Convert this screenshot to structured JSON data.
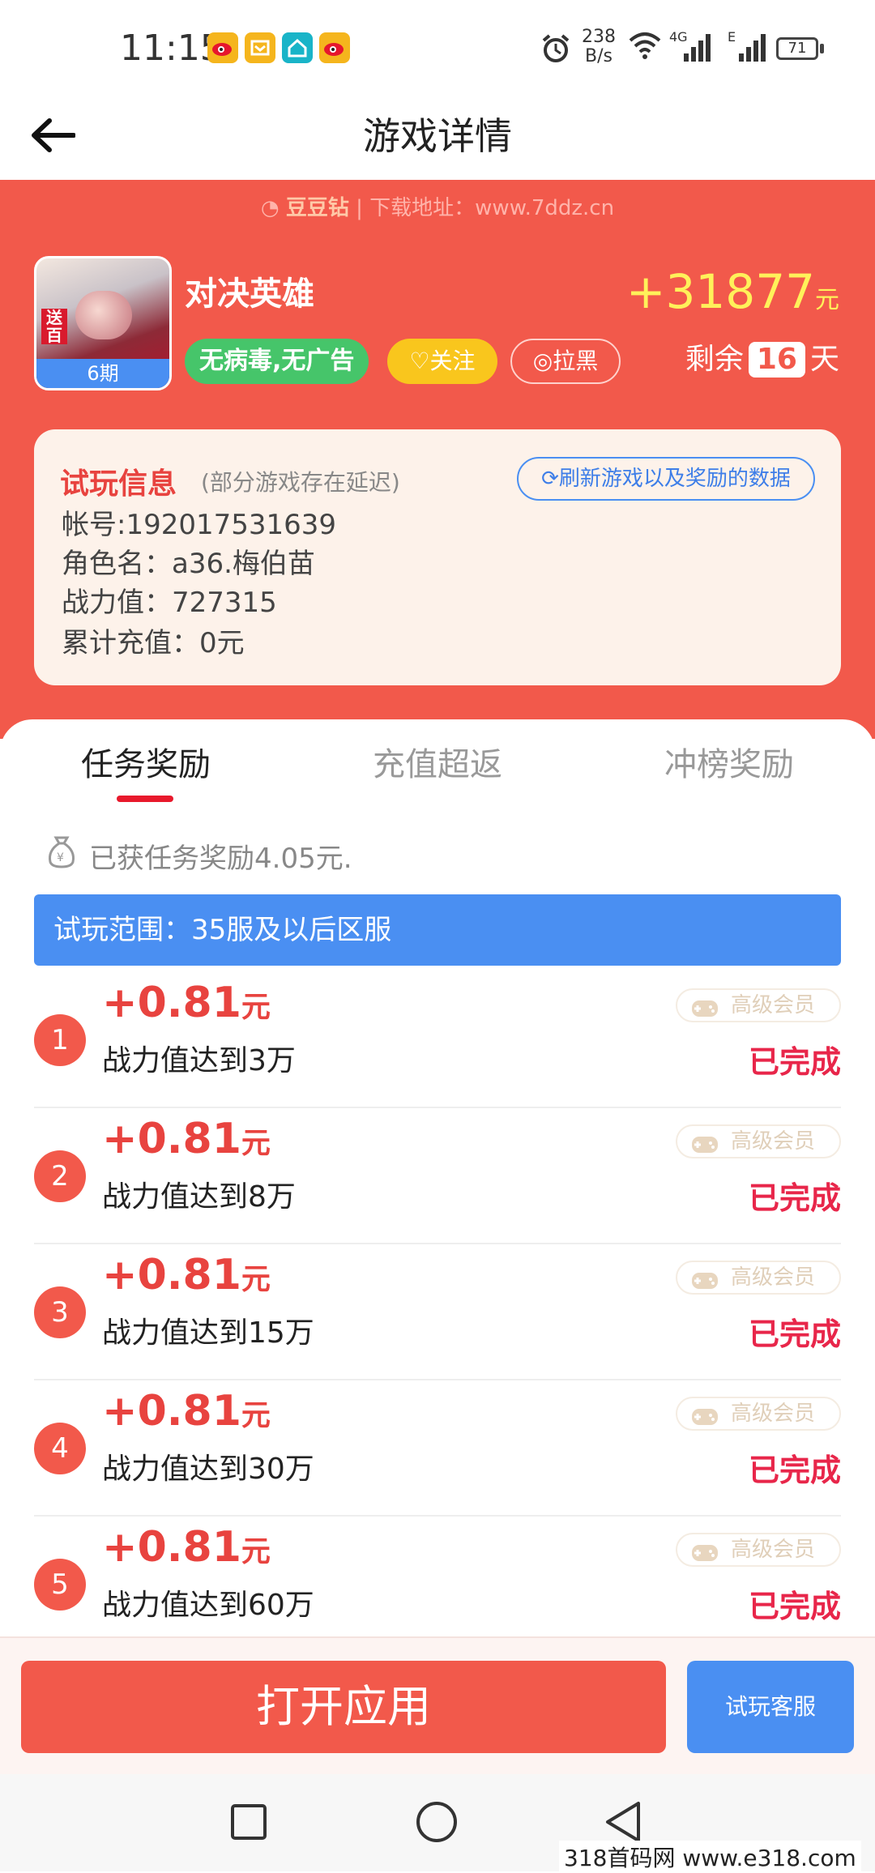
{
  "status_bar": {
    "time": "11:15",
    "net_speed_value": "238",
    "net_speed_unit": "B/s",
    "signal1_label": "4G",
    "signal2_label": "E",
    "battery": "71"
  },
  "header": {
    "title": "游戏详情"
  },
  "banner": {
    "brand": "豆豆钻",
    "separator": "|",
    "download_text": "下载地址：www.7ddz.cn"
  },
  "game": {
    "name": "对决英雄",
    "icon_tag": "送百",
    "period": "6期",
    "tag_safe": "无病毒,无广告",
    "follow_label": "关注",
    "block_label": "拉黑",
    "reward_amount": "+31877",
    "reward_unit": "元",
    "days_prefix": "剩余",
    "days_value": "16",
    "days_suffix": "天"
  },
  "trial_info": {
    "title": "试玩信息",
    "note": "(部分游戏存在延迟)",
    "refresh_label": "刷新游戏以及奖励的数据",
    "account": "帐号:192017531639",
    "role": "角色名：a36.梅伯苗",
    "power": "战力值：727315",
    "recharge": "累计充值：0元"
  },
  "tabs": [
    {
      "label": "任务奖励",
      "active": true
    },
    {
      "label": "充值超返",
      "active": false
    },
    {
      "label": "冲榜奖励",
      "active": false
    }
  ],
  "earned_text": "已获任务奖励4.05元.",
  "scope_text": "试玩范围：35服及以后区服",
  "tasks": [
    {
      "num": "1",
      "amount": "+0.81",
      "unit": "元",
      "desc": "战力值达到3万",
      "badge": "高级会员",
      "status": "已完成"
    },
    {
      "num": "2",
      "amount": "+0.81",
      "unit": "元",
      "desc": "战力值达到8万",
      "badge": "高级会员",
      "status": "已完成"
    },
    {
      "num": "3",
      "amount": "+0.81",
      "unit": "元",
      "desc": "战力值达到15万",
      "badge": "高级会员",
      "status": "已完成"
    },
    {
      "num": "4",
      "amount": "+0.81",
      "unit": "元",
      "desc": "战力值达到30万",
      "badge": "高级会员",
      "status": "已完成"
    },
    {
      "num": "5",
      "amount": "+0.81",
      "unit": "元",
      "desc": "战力值达到60万",
      "badge": "高级会员",
      "status": "已完成"
    }
  ],
  "actions": {
    "open_app": "打开应用",
    "service": "试玩客服"
  },
  "site_watermark": "318首码网 www.e318.com",
  "colors": {
    "primary_red": "#f2594b",
    "accent_blue": "#4a8ff2",
    "success_green": "#46c56a",
    "follow_yellow": "#f9c61d",
    "status_red": "#e8264a"
  }
}
